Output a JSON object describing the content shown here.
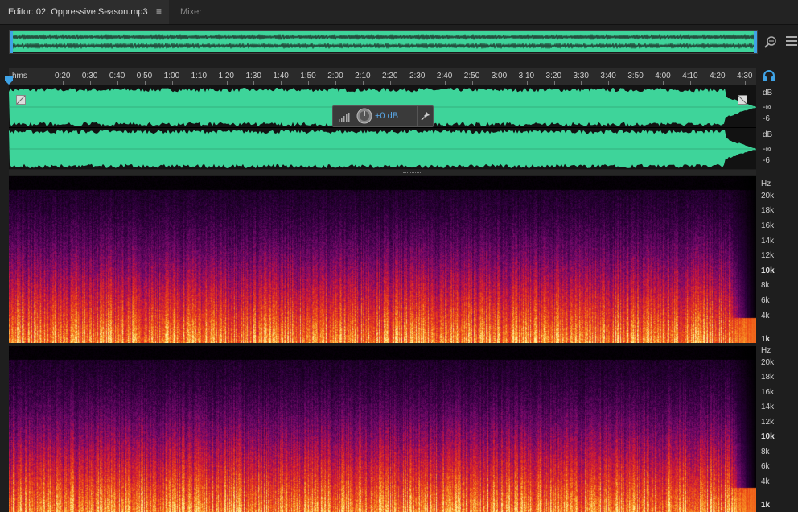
{
  "tabs": {
    "editor": "Editor: 02. Oppressive Season.mp3",
    "menu_glyph": "≡",
    "mixer": "Mixer"
  },
  "icons": {
    "zoom": "zoom-icon",
    "panel_menu": "hamburger-icon",
    "monitor": "headphones-icon",
    "playhead": "playhead-icon"
  },
  "colors": {
    "waveform": "#3ed49a",
    "accent": "#3fa3e6"
  },
  "ruler": {
    "unit": "hms",
    "ticks": [
      "0:20",
      "0:30",
      "0:40",
      "0:50",
      "1:00",
      "1:10",
      "1:20",
      "1:30",
      "1:40",
      "1:50",
      "2:00",
      "2:10",
      "2:20",
      "2:30",
      "2:40",
      "2:50",
      "3:00",
      "3:10",
      "3:20",
      "3:30",
      "3:40",
      "3:50",
      "4:00",
      "4:10",
      "4:20",
      "4:30"
    ]
  },
  "hud": {
    "volume": "+0 dB"
  },
  "waveform": {
    "channel1": {
      "unit": "dB",
      "labels": [
        "-∞",
        "-6"
      ]
    },
    "channel2": {
      "unit": "dB",
      "labels": [
        "-∞",
        "-6"
      ]
    }
  },
  "spectral": {
    "channel1": {
      "unit": "Hz",
      "labels": [
        "20k",
        "18k",
        "16k",
        "14k",
        "12k",
        "10k",
        "8k",
        "6k",
        "4k",
        "1k"
      ]
    },
    "channel2": {
      "unit": "Hz",
      "labels": [
        "20k",
        "18k",
        "16k",
        "14k",
        "12k",
        "10k",
        "8k",
        "6k",
        "4k",
        "1k"
      ]
    }
  }
}
